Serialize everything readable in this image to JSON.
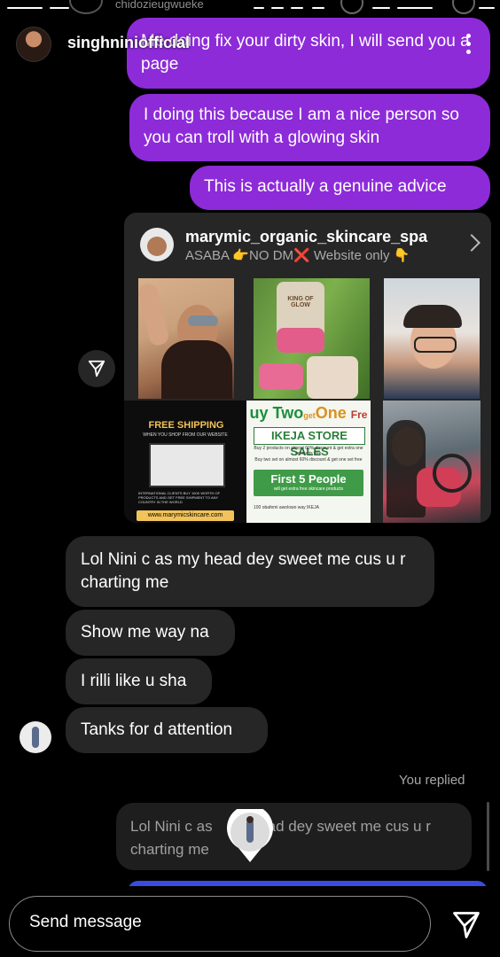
{
  "top": {
    "username": "chidozieugwueke"
  },
  "story": {
    "username": "singhniniofficial"
  },
  "messages_sent": [
    "Me doing fix your dirty skin, I will send you a page",
    "I doing this because I am a nice person so you can troll with a glowing skin",
    "This is actually a genuine advice"
  ],
  "shared_post": {
    "username": "marymic_organic_skincare_spa",
    "bio": "ASABA 👉NO DM❌ Website only 👇",
    "tile_free_shipping": {
      "title": "FREE SHIPPING",
      "subtitle": "WHEN YOU SHOP FROM OUR WEBSITE",
      "text": "INTERNATIONAL CLIENTS BUY 100K WORTH OF PRODUCTS AND GET FREE SHIPMENT TO ANY COUNTRY IN THE WORLD",
      "url": "www.marymicskincare.com"
    },
    "tile_store_sales": {
      "headline_a": "uy Two",
      "headline_get": "get",
      "headline_b": "One",
      "headline_c": "Fre",
      "banner": "IKEJA STORE SALES",
      "line1": "Buy 2 products on almost 60% discount & get extra one products free",
      "line2": "Buy two set on almost 60% discount & get one set free",
      "green_title": "First 5 People",
      "green_sub": "will get extra free skincare products",
      "footer": "100 obafemi awolowo way IKEJA"
    },
    "tile_jar_text": "KING OF GLOW"
  },
  "messages_received": [
    "Lol Nini c as my head dey sweet me cus u r charting me",
    "Show me way na",
    "I rilli like u sha",
    "Tanks for d attention"
  ],
  "reply": {
    "label": "You replied",
    "quoted_before": "Lol Nini c as",
    "quoted_after": "ad dey sweet me cus u r",
    "quoted_line2": "charting me"
  },
  "composer": {
    "placeholder": "Send message"
  },
  "colors": {
    "sent_bubble": "#8d2bd9",
    "received_bubble": "#262626",
    "background": "#000000"
  },
  "icons": {
    "more": "more-vertical-icon",
    "share": "paper-plane-icon",
    "send": "paper-plane-icon",
    "chevron": "chevron-right-icon"
  }
}
